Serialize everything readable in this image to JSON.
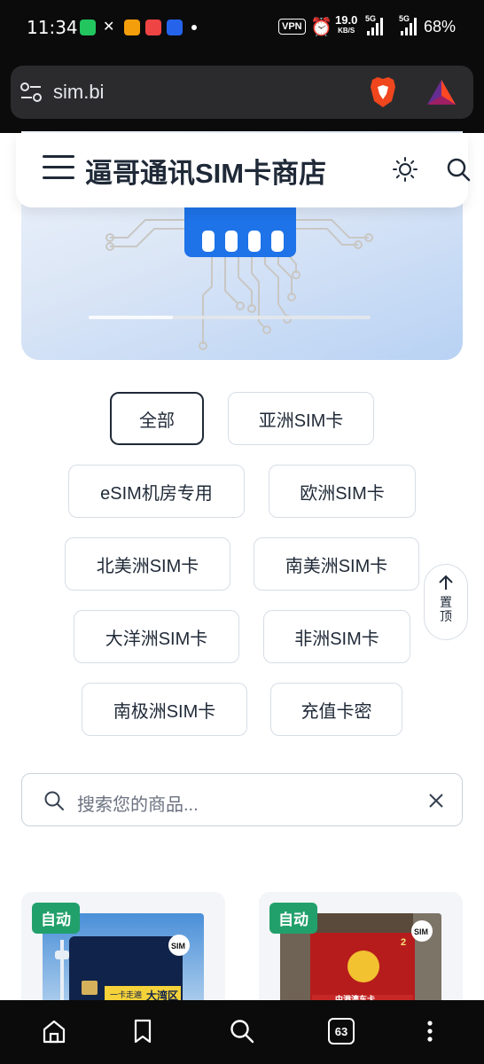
{
  "status_bar": {
    "time": "11:34",
    "vpn": "VPN",
    "speed_value": "19.0",
    "speed_unit": "KB/S",
    "net1": "5G",
    "net2": "5G",
    "battery": "68%",
    "icons": [
      "wechat-icon",
      "x-icon",
      "app-icon",
      "app-icon",
      "app-icon",
      "alarm-icon",
      "signal-icon",
      "battery-icon"
    ]
  },
  "browser": {
    "url": "sim.bi",
    "icons": [
      "site-settings-icon",
      "brave-shields-icon",
      "brave-rewards-icon"
    ]
  },
  "header": {
    "title": "逼哥通讯SIM卡商店",
    "icons": [
      "menu-icon",
      "theme-toggle-icon",
      "search-icon"
    ]
  },
  "banner": {
    "slider_progress": 0.3
  },
  "categories": [
    {
      "label": "全部",
      "active": true
    },
    {
      "label": "亚洲SIM卡",
      "active": false
    },
    {
      "label": "eSIM机房专用",
      "active": false
    },
    {
      "label": "欧洲SIM卡",
      "active": false
    },
    {
      "label": "北美洲SIM卡",
      "active": false
    },
    {
      "label": "南美洲SIM卡",
      "active": false
    },
    {
      "label": "大洋洲SIM卡",
      "active": false
    },
    {
      "label": "非洲SIM卡",
      "active": false
    },
    {
      "label": "南极洲SIM卡",
      "active": false
    },
    {
      "label": "充值卡密",
      "active": false
    }
  ],
  "back_to_top": {
    "label": "置顶"
  },
  "search": {
    "placeholder": "搜索您的商品..."
  },
  "products": [
    {
      "badge": "自动",
      "card_text": "一卡走遍",
      "card_brand": "大湾区",
      "logo": "SIM"
    },
    {
      "badge": "自动",
      "card_text": "中港澳车卡",
      "card_price": "2",
      "logo": "SIM"
    }
  ],
  "bottom_nav": {
    "tab_count": "63",
    "icons": [
      "home-icon",
      "bookmark-icon",
      "search-icon",
      "tabs-icon",
      "more-icon"
    ]
  },
  "colors": {
    "accent_badge": "#22a06b",
    "sim_blue": "#1e73e8",
    "text": "#1f2937"
  }
}
